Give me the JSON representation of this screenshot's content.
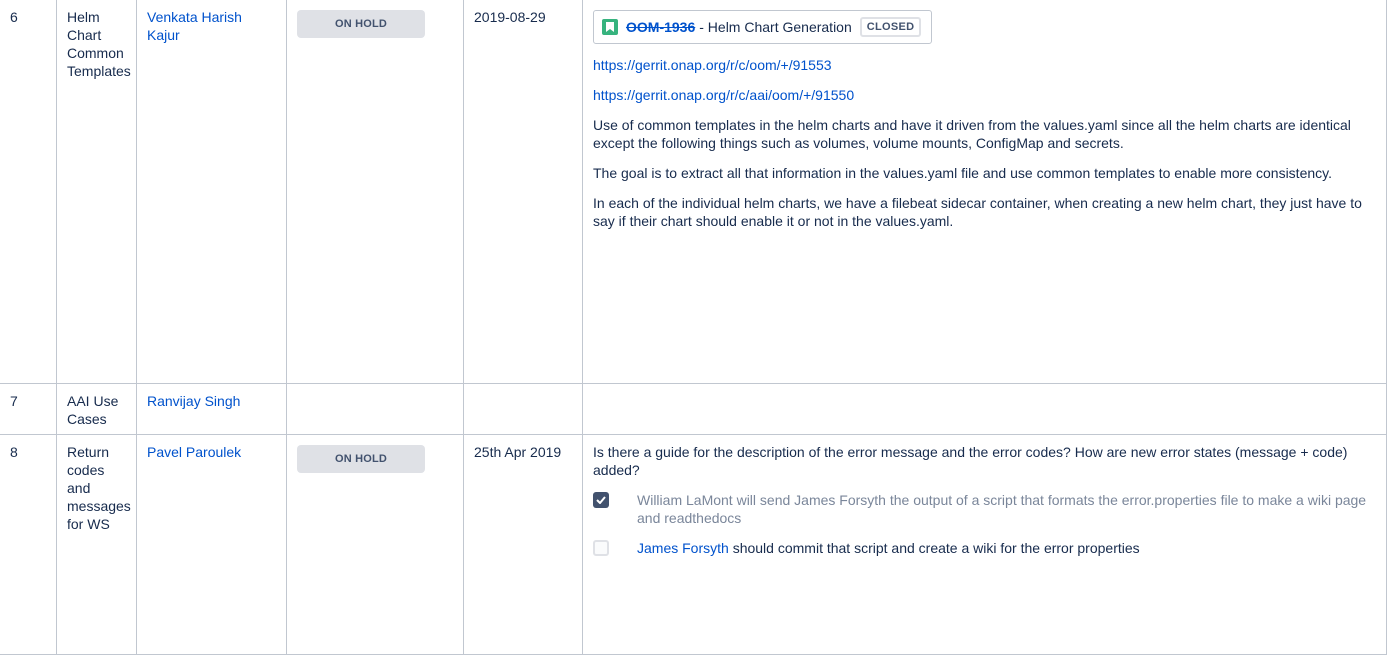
{
  "rows": [
    {
      "num": "6",
      "topic": "Helm Chart Common Templates",
      "owner": "Venkata Harish Kajur",
      "status": "ON HOLD",
      "date": "2019-08-29",
      "jira": {
        "key": "OOM-1936",
        "summary": "- Helm Chart Generation",
        "status": "CLOSED"
      },
      "links": [
        "https://gerrit.onap.org/r/c/oom/+/91553",
        "https://gerrit.onap.org/r/c/aai/oom/+/91550"
      ],
      "paragraphs": [
        "Use of common templates in the helm charts and have it driven from the values.yaml since all the helm charts are identical except the following things such as volumes, volume mounts, ConfigMap and secrets.",
        "The goal is to extract all that information in the values.yaml file and use common templates to enable more consistency.",
        "In each of the individual helm charts, we have a filebeat sidecar container, when creating a new helm chart, they just have to say if their chart should enable it or not in the values.yaml."
      ]
    },
    {
      "num": "7",
      "topic": "AAI Use Cases",
      "owner": "Ranvijay Singh"
    },
    {
      "num": "8",
      "topic": "Return codes and messages for WS",
      "owner": "Pavel Paroulek",
      "status": "ON HOLD",
      "date": "25th Apr 2019",
      "question": "Is there a guide for the description of the error message and the error codes? How are new error states (message + code) added?",
      "tasks": [
        {
          "checked": true,
          "text": "William LaMont will send James Forsyth the output of a script that formats the error.properties file to make a wiki page and readthedocs"
        },
        {
          "checked": false,
          "mention": "James Forsyth",
          "text": " should commit that script and create a wiki for the error properties"
        }
      ]
    }
  ],
  "colors": {
    "link": "#0052cc",
    "lozenge_bg": "#dfe1e6",
    "jira_icon": "#36b37e",
    "border": "#c1c7d0"
  },
  "icons": {
    "jira_issue": "bookmark-icon",
    "checkbox_checked": "check-icon"
  }
}
